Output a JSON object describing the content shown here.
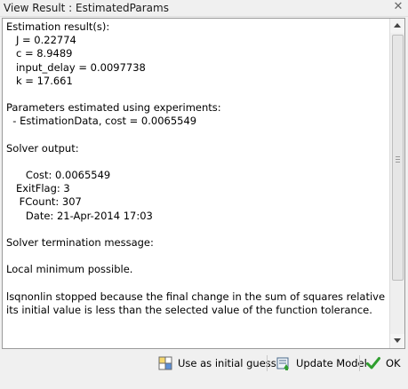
{
  "window": {
    "title": "View Result : EstimatedParams",
    "close_glyph": "✕"
  },
  "result_lines": [
    "Estimation result(s):",
    "   J = 0.22774",
    "   c = 8.9489",
    "   input_delay = 0.0097738",
    "   k = 17.661",
    "",
    "Parameters estimated using experiments:",
    "  - EstimationData, cost = 0.0065549",
    "",
    "Solver output:",
    "",
    "      Cost: 0.0065549",
    "   ExitFlag: 3",
    "    FCount: 307",
    "      Date: 21-Apr-2014 17:03",
    "",
    "Solver termination message:",
    "",
    "Local minimum possible.",
    "",
    "lsqnonlin stopped because the final change in the sum of squares relative to",
    "its initial value is less than the selected value of the function tolerance."
  ],
  "buttons": {
    "use_initial": {
      "label": "Use as initial guess",
      "icon": "grid-table-icon"
    },
    "update_model": {
      "label": "Update Model",
      "icon": "update-model-icon"
    },
    "ok": {
      "label": "OK",
      "icon": "checkmark-icon"
    }
  },
  "colors": {
    "accent_green": "#2f9e2f",
    "grid_yellow": "#f5d76e",
    "grid_blue": "#5b8fd6"
  }
}
